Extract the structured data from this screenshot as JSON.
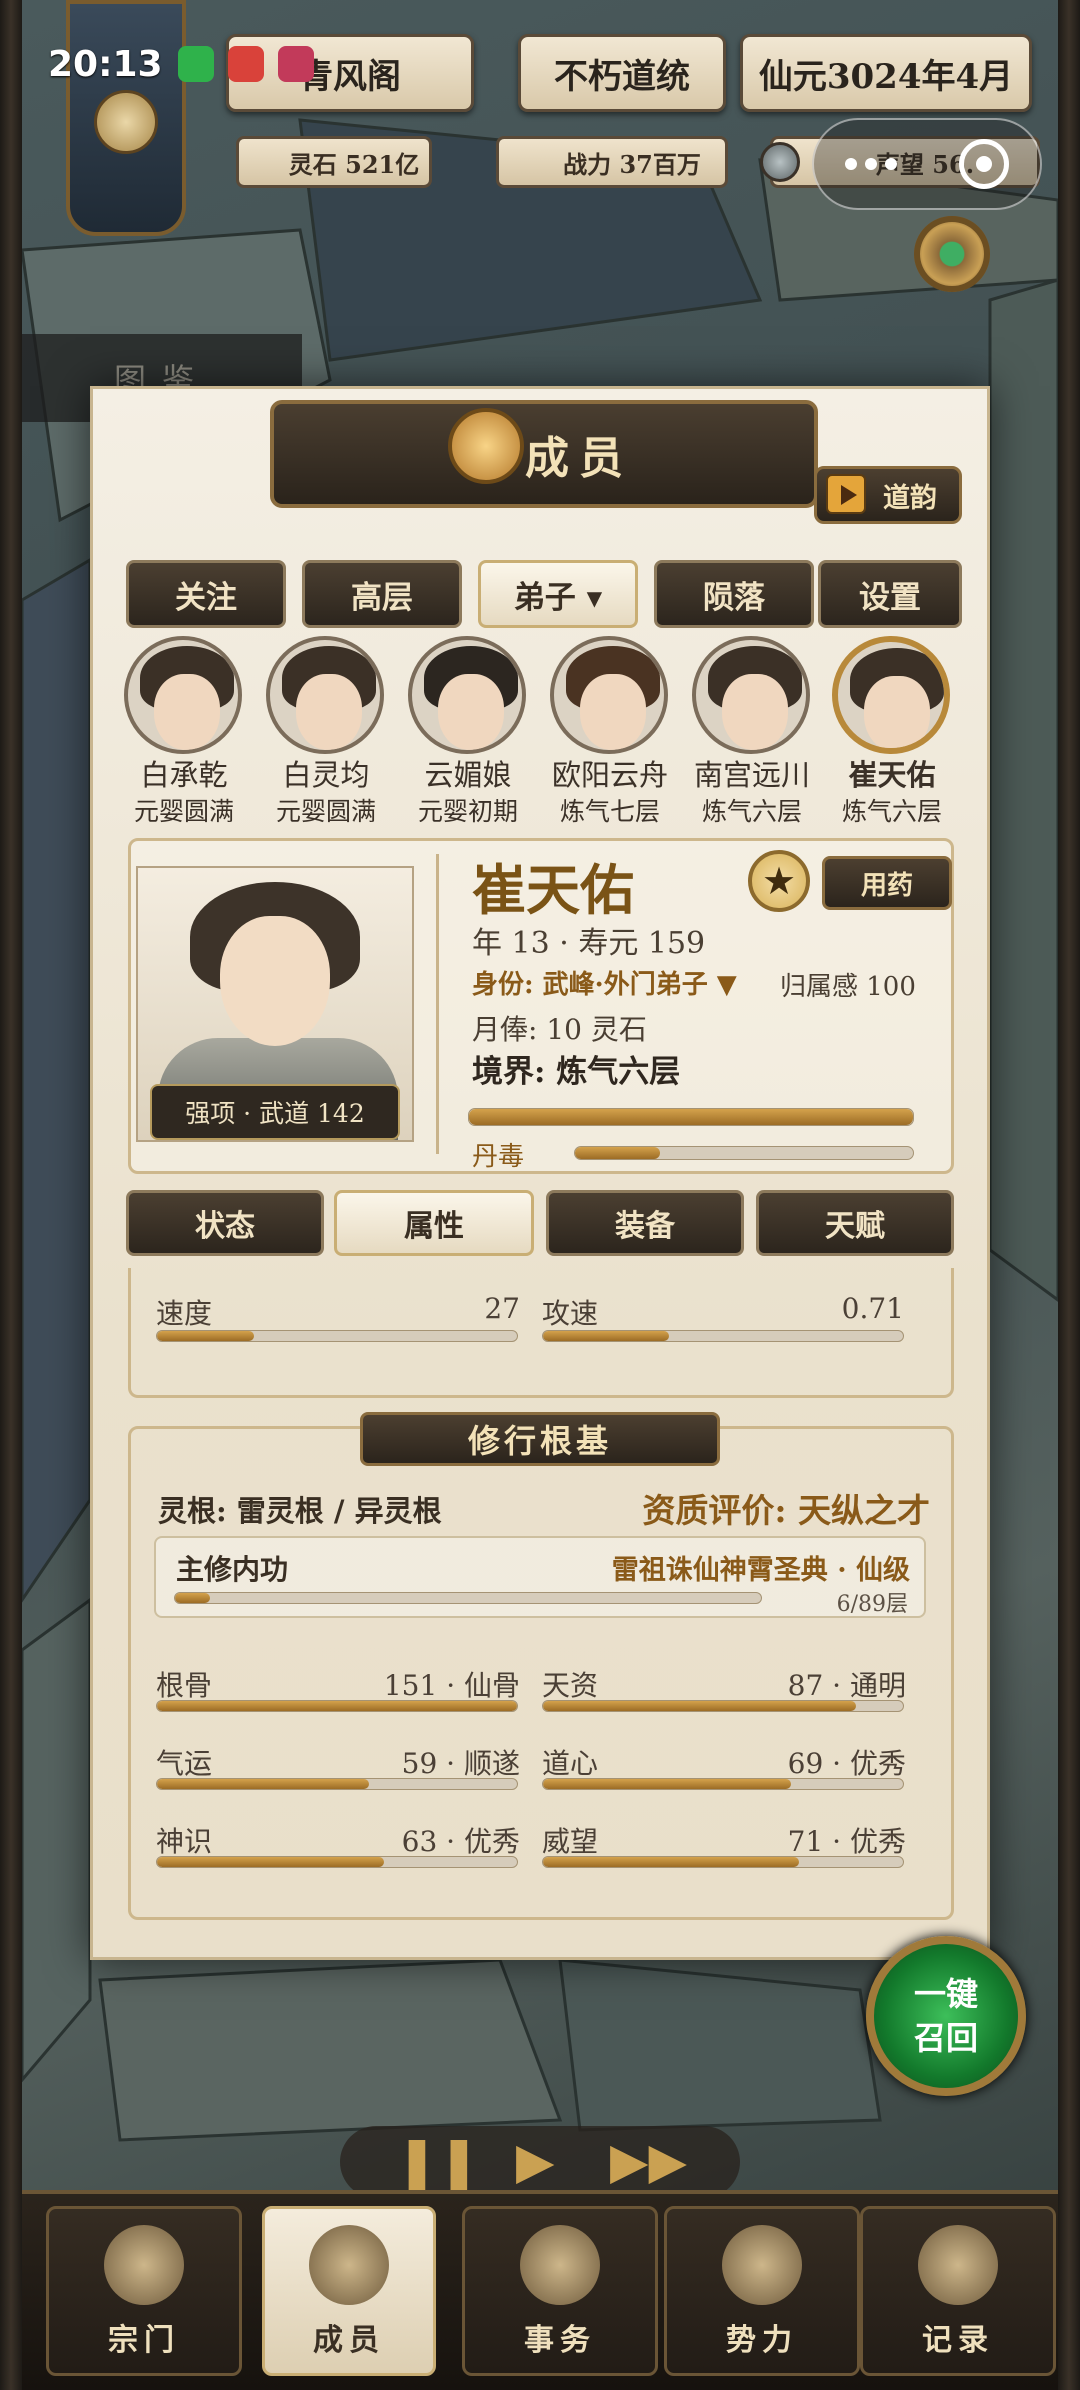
{
  "status": {
    "time": "20:13"
  },
  "top": {
    "sect_name": "青风阁",
    "lineage": "不朽道统",
    "date": "仙元3024年4月"
  },
  "stats": {
    "spirit_stone": "灵石 521亿",
    "power": "战力 37百万",
    "reputation": "声望 56."
  },
  "side_tab": "图鉴",
  "panel": {
    "title": "成员",
    "daoyun": "道韵"
  },
  "tabs": [
    {
      "label": "关注"
    },
    {
      "label": "高层"
    },
    {
      "label": "弟子 ▾"
    },
    {
      "label": "陨落"
    },
    {
      "label": "设置"
    }
  ],
  "members": [
    {
      "name": "白承乾",
      "rank": "元婴圆满"
    },
    {
      "name": "白灵均",
      "rank": "元婴圆满"
    },
    {
      "name": "云媚娘",
      "rank": "元婴初期"
    },
    {
      "name": "欧阳云舟",
      "rank": "炼气七层"
    },
    {
      "name": "南宫远川",
      "rank": "炼气六层"
    },
    {
      "name": "崔天佑",
      "rank": "炼气六层"
    }
  ],
  "detail": {
    "name": "崔天佑",
    "strength": "强项 · 武道 142",
    "medicine_btn": "用药",
    "age_line": "年 13 · 寿元 159",
    "identity": "身份: 武峰·外门弟子 ▼",
    "belonging": "归属感 100",
    "salary": "月俸: 10 灵石",
    "realm": "境界: 炼气六层",
    "cultivation_progress": 1.0,
    "poison_label": "丹毒",
    "poison_progress": 0.25
  },
  "attr_tabs": [
    {
      "label": "状态"
    },
    {
      "label": "属性"
    },
    {
      "label": "装备"
    },
    {
      "label": "天赋"
    }
  ],
  "attrs": [
    {
      "label": "速度",
      "value": "27",
      "fill": 0.27
    },
    {
      "label": "攻速",
      "value": "0.71",
      "fill": 0.35
    }
  ],
  "cultivation": {
    "title": "修行根基",
    "linggen": "灵根: 雷灵根 / 异灵根",
    "aptitude": "资质评价: 天纵之才",
    "method_label": "主修内功",
    "method_name": "雷祖诛仙神霄圣典 · 仙级",
    "method_progress_text": "6/89层",
    "method_progress": 0.06,
    "stats": [
      {
        "label": "根骨",
        "value": "151 · 仙骨",
        "fill": 1.0
      },
      {
        "label": "天资",
        "value": "87 · 通明",
        "fill": 0.87
      },
      {
        "label": "气运",
        "value": "59 · 顺遂",
        "fill": 0.59
      },
      {
        "label": "道心",
        "value": "69 · 优秀",
        "fill": 0.69
      },
      {
        "label": "神识",
        "value": "63 · 优秀",
        "fill": 0.63
      },
      {
        "label": "威望",
        "value": "71 · 优秀",
        "fill": 0.71
      }
    ]
  },
  "recall": {
    "line1": "一键",
    "line2": "召回"
  },
  "nav": [
    {
      "label": "宗门"
    },
    {
      "label": "成员"
    },
    {
      "label": "事务"
    },
    {
      "label": "势力"
    },
    {
      "label": "记录"
    }
  ],
  "colors": {
    "accent": "#b8893a",
    "panel": "#f4efe4",
    "dark": "#2b241c",
    "recall": "#137a2c"
  }
}
